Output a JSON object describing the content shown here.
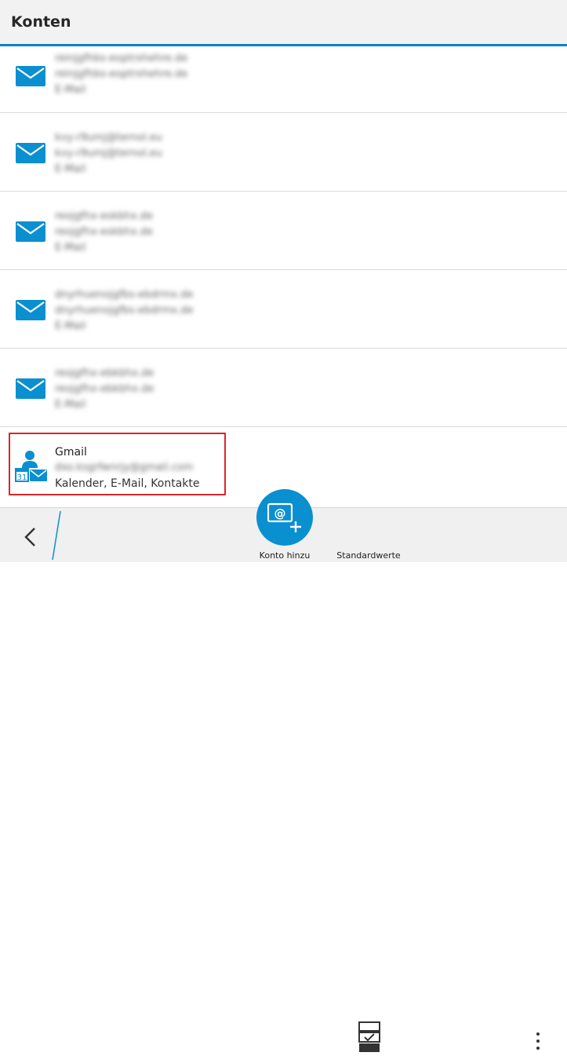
{
  "header": {
    "title": "Konten"
  },
  "accounts": [
    {
      "line1": "reinjgfhbs-eoptrxhehre.de",
      "line2": "reinjgfhbs-eoptrxhehre.de",
      "line3": "E-Mail"
    },
    {
      "line1": "kvy-r9umj@ternol.eu",
      "line2": "kvy-r9umj@ternol.eu",
      "line3": "E-Mail"
    },
    {
      "line1": "reojgfhx-eskbhx.de",
      "line2": "reojgfhx-eskbhx.de",
      "line3": "E-Mail"
    },
    {
      "line1": "dnyrhuenojgfbs-ebdrmx.de",
      "line2": "dnyrhuenojgfbs-ebdrmx.de",
      "line3": "E-Mail"
    },
    {
      "line1": "reojgfhx-ebkbhx.de",
      "line2": "reojgfhx-ebkbhx.de",
      "line3": "E-Mail"
    }
  ],
  "gmail": {
    "name": "Gmail",
    "address": "dxo.ksgrfwnrjy@gmail.com",
    "types": "Kalender, E-Mail, Kontakte",
    "calendar_day": "31"
  },
  "toolbar": {
    "add_label": "Konto hinzu",
    "defaults_label": "Standardwerte"
  },
  "colors": {
    "accent": "#0a8fd0",
    "highlight": "#d8262c"
  }
}
